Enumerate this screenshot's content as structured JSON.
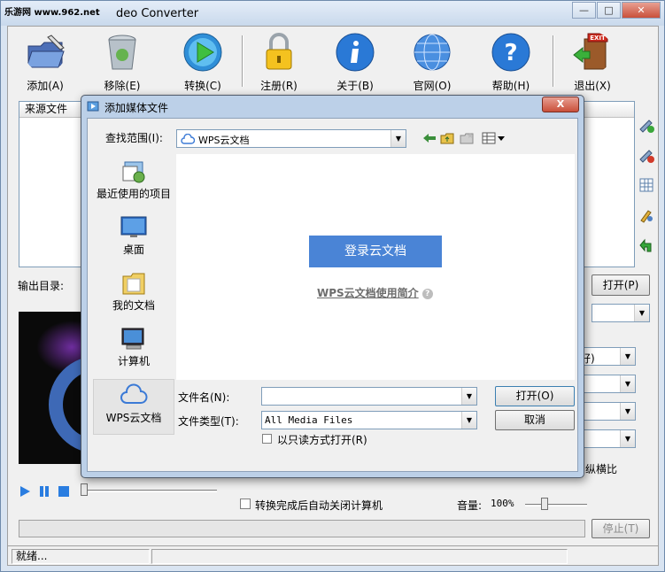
{
  "window": {
    "app_badge": "乐游网 www.962.net",
    "title": "deo Converter",
    "minimize": "—",
    "maximize": "□",
    "close": "✕"
  },
  "toolbar": {
    "add": "添加(A)",
    "remove": "移除(E)",
    "convert": "转换(C)",
    "register": "注册(R)",
    "about": "关于(B)",
    "website": "官网(O)",
    "help": "帮助(H)",
    "exit": "退出(X)",
    "exit_sign": "EXIT"
  },
  "filelist": {
    "col_source": "来源文件"
  },
  "output": {
    "dir_label": "输出目录:",
    "open_button": "打开(P)"
  },
  "settings": {
    "combo1_suffix": "好)",
    "aspect_suffix": "纵横比"
  },
  "bottom": {
    "auto_shutdown": "转换完成后自动关闭计算机",
    "volume_label": "音量:",
    "volume_value": "100%",
    "stop_button": "停止(T)"
  },
  "status": {
    "text": "就绪..."
  },
  "dialog": {
    "title": "添加媒体文件",
    "close": "X",
    "look_in_label": "查找范围(I):",
    "look_in_value": "WPS云文档",
    "places": [
      {
        "label": "最近使用的项目"
      },
      {
        "label": "桌面"
      },
      {
        "label": "我的文档"
      },
      {
        "label": "计算机"
      },
      {
        "label": "WPS云文档"
      }
    ],
    "login_button": "登录云文档",
    "intro_link": "WPS云文档使用简介",
    "help_mark": "?",
    "filename_label": "文件名(N):",
    "filename_value": "",
    "filetype_label": "文件类型(T):",
    "filetype_value": "All Media Files",
    "readonly_label": "以只读方式打开(R)",
    "open_button": "打开(O)",
    "cancel_button": "取消"
  }
}
